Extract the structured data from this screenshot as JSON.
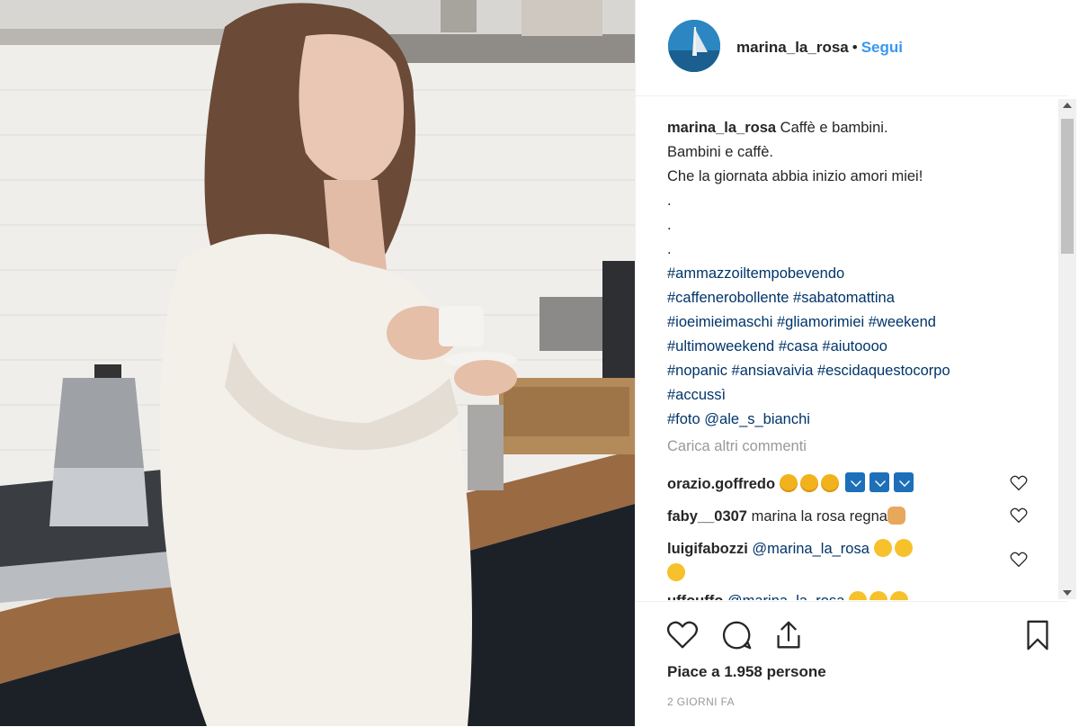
{
  "post": {
    "username": "marina_la_rosa",
    "separator": "•",
    "follow_label": "Segui",
    "caption": {
      "author": "marina_la_rosa",
      "lines": [
        "Caffè e bambini.",
        "Bambini e caffè.",
        "Che la giornata abbia inizio amori miei!",
        ".",
        ".",
        "."
      ],
      "hashtag_lines": [
        "#ammazzoiltempobevendo",
        "#caffenerobollente #sabatomattina",
        "#ioeimieimaschi #gliamorimiei #weekend",
        "#ultimoweekend #casa #aiutoooo",
        "#nopanic #ansiavaivia #escidaquestocorpo",
        "#accussì"
      ],
      "credit_prefix": "#foto",
      "credit_mention": "@ale_s_bianchi"
    },
    "load_more_label": "Carica altri commenti",
    "comments": [
      {
        "user": "orazio.goffredo",
        "text": ""
      },
      {
        "user": "faby__0307",
        "text": "marina la rosa regna"
      },
      {
        "user": "luigifabozzi",
        "text": "@marina_la_rosa"
      },
      {
        "user": "uffouffo",
        "text": "@marina_la_rosa"
      }
    ],
    "likes_label": "Piace a 1.958 persone",
    "date_label": "2 GIORNI FA"
  },
  "colors": {
    "link": "#3897f0",
    "hashtag": "#003569",
    "muted": "#999999"
  },
  "icons": [
    "heart-icon",
    "comment-icon",
    "share-icon",
    "bookmark-icon",
    "like-comment-icon"
  ]
}
